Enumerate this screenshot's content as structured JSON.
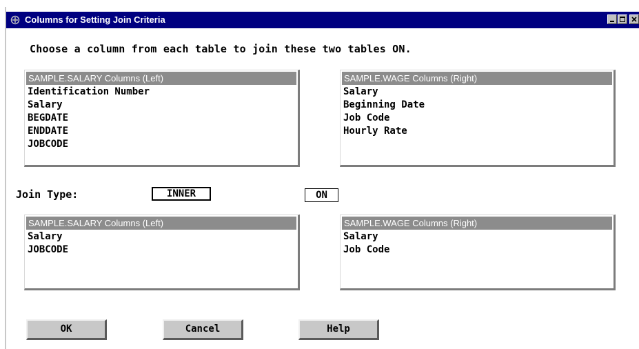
{
  "window": {
    "title": "Columns for Setting Join Criteria",
    "icon": "sas-app-icon",
    "controls": [
      "minimize-icon",
      "maximize-icon",
      "close-icon"
    ],
    "title_bar_color": "#000080"
  },
  "instruction": "Choose a column from each table to join these two tables ON.",
  "available": {
    "left": {
      "header": "SAMPLE.SALARY Columns (Left)",
      "items": [
        "Identification Number",
        "Salary",
        "BEGDATE",
        "ENDDATE",
        "JOBCODE"
      ]
    },
    "right": {
      "header": "SAMPLE.WAGE Columns (Right)",
      "items": [
        "Salary",
        "Beginning Date",
        "Job Code",
        "Hourly Rate"
      ]
    }
  },
  "join": {
    "label": "Join Type:",
    "type_value": "INNER",
    "on_value": "ON"
  },
  "selected": {
    "left": {
      "header": "SAMPLE.SALARY Columns (Left)",
      "items": [
        "Salary",
        "JOBCODE"
      ]
    },
    "right": {
      "header": "SAMPLE.WAGE Columns (Right)",
      "items": [
        "Salary",
        "Job Code"
      ]
    }
  },
  "buttons": {
    "ok": "OK",
    "cancel": "Cancel",
    "help": "Help"
  },
  "colors": {
    "list_header_bg": "#8c8c8c",
    "button_face": "#c8c8c8"
  }
}
